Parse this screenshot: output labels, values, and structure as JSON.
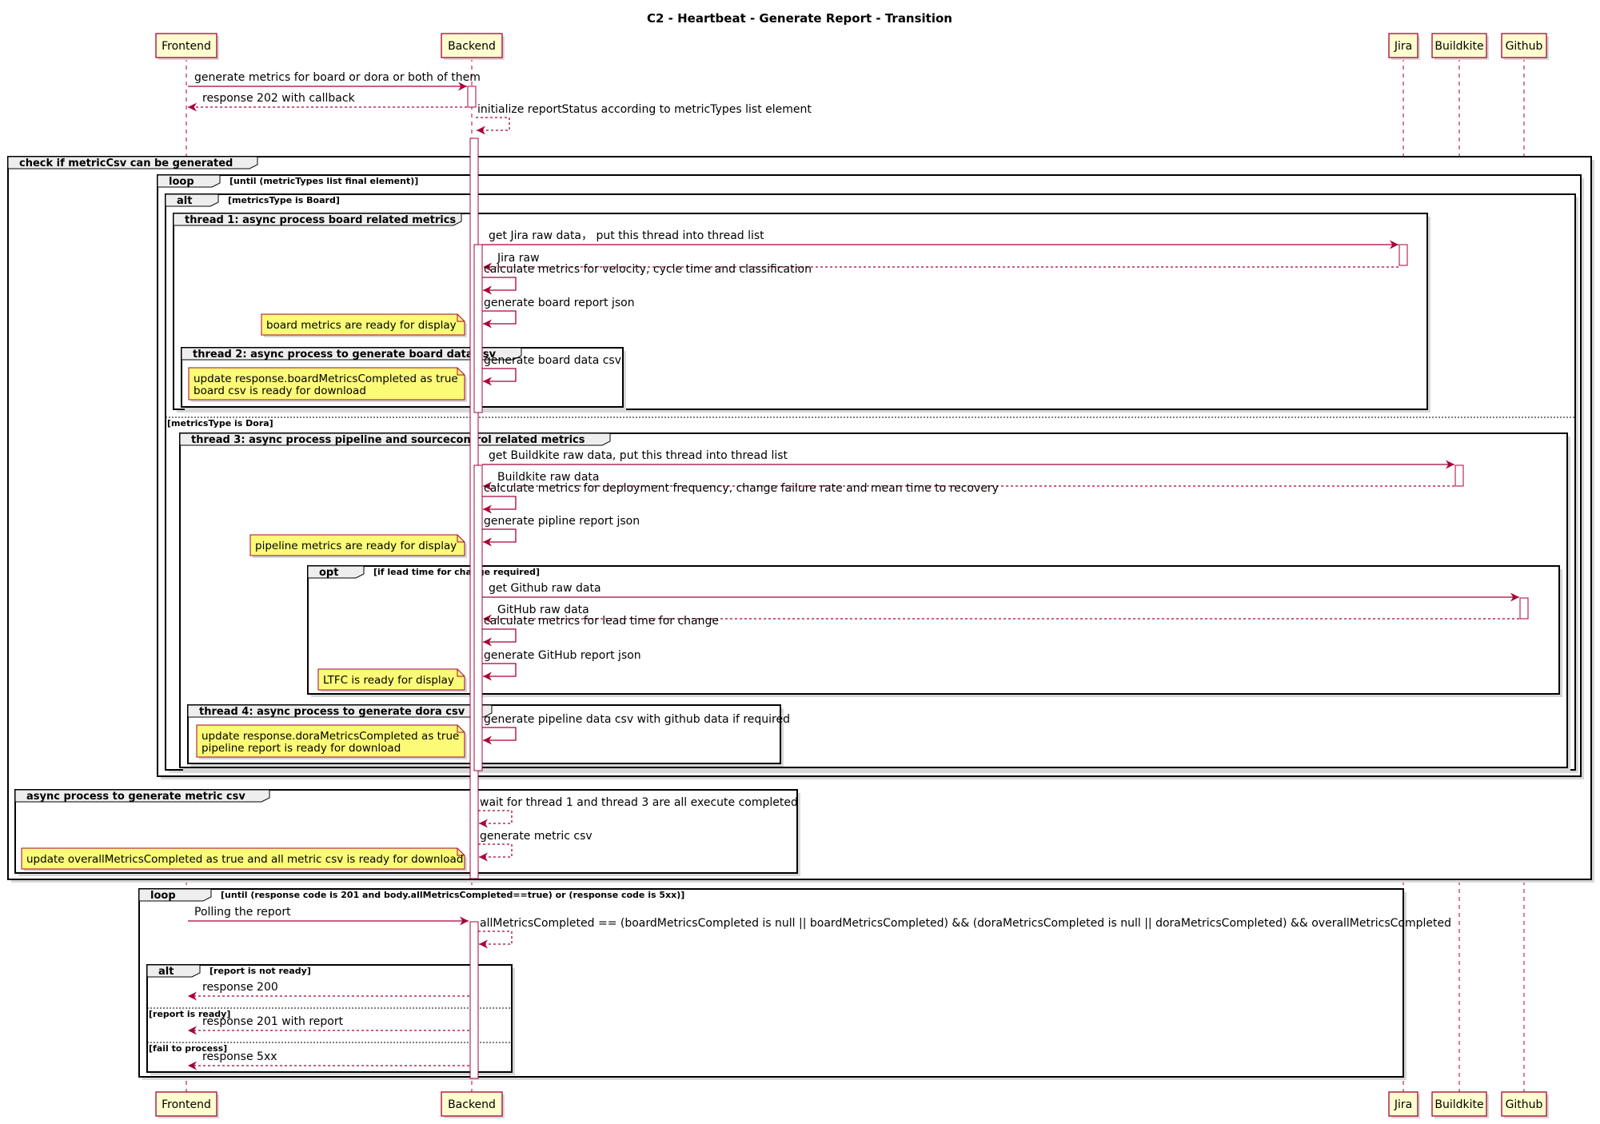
{
  "title": "C2 - Heartbeat - Generate Report - Transition",
  "colors": {
    "line": "#A80036",
    "participant_fill": "#FEFECE",
    "note_fill": "#FBFB77",
    "shadow": "#d8d8d8"
  },
  "participants": [
    {
      "id": "frontend",
      "label": "Frontend"
    },
    {
      "id": "backend",
      "label": "Backend"
    },
    {
      "id": "jira",
      "label": "Jira"
    },
    {
      "id": "buildkite",
      "label": "Buildkite"
    },
    {
      "id": "github",
      "label": "Github"
    }
  ],
  "groups": [
    {
      "id": "g-main",
      "kind": "group",
      "label": "check if metricCsv can be generated"
    },
    {
      "id": "g-loop1",
      "kind": "loop",
      "label": "loop",
      "condition": "[until (metricTypes list final element)]"
    },
    {
      "id": "g-alt1",
      "kind": "alt",
      "label": "alt",
      "condition": "[metricsType is Board]",
      "else": [
        "[metricsType is Dora]"
      ]
    },
    {
      "id": "g-t1",
      "kind": "group",
      "label": "thread 1: async process board related metrics"
    },
    {
      "id": "g-t2",
      "kind": "group",
      "label": "thread 2: async process to generate board data csv"
    },
    {
      "id": "g-t3",
      "kind": "group",
      "label": "thread 3: async process pipeline and sourcecontrol related metrics"
    },
    {
      "id": "g-opt",
      "kind": "opt",
      "label": "opt",
      "condition": "[if lead time for change required]"
    },
    {
      "id": "g-t4",
      "kind": "group",
      "label": "thread 4: async process to generate dora csv"
    },
    {
      "id": "g-async",
      "kind": "group",
      "label": "async process to generate metric csv"
    },
    {
      "id": "g-loop2",
      "kind": "loop",
      "label": "loop",
      "condition": "[until (response code is 201 and body.allMetricsCompleted==true) or (response code is 5xx)]"
    },
    {
      "id": "g-alt2",
      "kind": "alt",
      "label": "alt",
      "condition": "[report is not ready]",
      "else": [
        "[report is ready]",
        "[fail to process]"
      ]
    }
  ],
  "messages": [
    {
      "from": "frontend",
      "to": "backend",
      "text": "generate metrics for board or dora or both of them",
      "dashed": false
    },
    {
      "from": "backend",
      "to": "frontend",
      "text": "response 202 with callback",
      "dashed": true
    },
    {
      "from": "backend",
      "to": "backend",
      "text": "initialize reportStatus according to metricTypes list element",
      "dashed": true
    },
    {
      "from": "backend",
      "to": "jira",
      "text": "get Jira raw data， put this thread into thread list",
      "dashed": false
    },
    {
      "from": "jira",
      "to": "backend",
      "text": "Jira raw",
      "dashed": true
    },
    {
      "from": "backend",
      "to": "backend",
      "text": "calculate metrics for velocity, cycle time and classification",
      "dashed": false
    },
    {
      "from": "backend",
      "to": "backend",
      "text": "generate board report json",
      "dashed": false
    },
    {
      "from": "backend",
      "to": "backend",
      "text": "generate board data csv",
      "dashed": false
    },
    {
      "from": "backend",
      "to": "buildkite",
      "text": "get Buildkite raw data, put this thread into thread list",
      "dashed": false
    },
    {
      "from": "buildkite",
      "to": "backend",
      "text": "Buildkite raw data",
      "dashed": true
    },
    {
      "from": "backend",
      "to": "backend",
      "text": "calculate metrics for deployment frequency, change failure rate and mean time to recovery",
      "dashed": false
    },
    {
      "from": "backend",
      "to": "backend",
      "text": "generate pipline report json",
      "dashed": false
    },
    {
      "from": "backend",
      "to": "github",
      "text": "get Github raw data",
      "dashed": false
    },
    {
      "from": "github",
      "to": "backend",
      "text": "GitHub raw data",
      "dashed": true
    },
    {
      "from": "backend",
      "to": "backend",
      "text": "calculate metrics for lead time for change",
      "dashed": false
    },
    {
      "from": "backend",
      "to": "backend",
      "text": "generate GitHub report json",
      "dashed": false
    },
    {
      "from": "backend",
      "to": "backend",
      "text": "generate pipeline data csv with github data if required",
      "dashed": false
    },
    {
      "from": "backend",
      "to": "backend",
      "text": "wait for thread 1 and thread 3 are all execute completed",
      "dashed": true
    },
    {
      "from": "backend",
      "to": "backend",
      "text": "generate metric csv",
      "dashed": true
    },
    {
      "from": "frontend",
      "to": "backend",
      "text": "Polling the report",
      "dashed": false
    },
    {
      "from": "backend",
      "to": "backend",
      "text": "allMetricsCompleted == (boardMetricsCompleted is null || boardMetricsCompleted) && (doraMetricsCompleted is null || doraMetricsCompleted) && overallMetricsCompleted",
      "dashed": true
    },
    {
      "from": "backend",
      "to": "frontend",
      "text": "response 200",
      "dashed": true
    },
    {
      "from": "backend",
      "to": "frontend",
      "text": "response 201 with report",
      "dashed": true
    },
    {
      "from": "backend",
      "to": "frontend",
      "text": "response 5xx",
      "dashed": true
    }
  ],
  "notes": [
    {
      "lines": [
        "board metrics are ready for display"
      ]
    },
    {
      "lines": [
        "update response.boardMetricsCompleted as true",
        "board csv is ready for download"
      ]
    },
    {
      "lines": [
        "pipeline metrics are ready for display"
      ]
    },
    {
      "lines": [
        "LTFC is ready for display"
      ]
    },
    {
      "lines": [
        "update response.doraMetricsCompleted as true",
        "pipeline report is ready for download"
      ]
    },
    {
      "lines": [
        "update overallMetricsCompleted as true and all metric csv is ready for download"
      ]
    }
  ]
}
